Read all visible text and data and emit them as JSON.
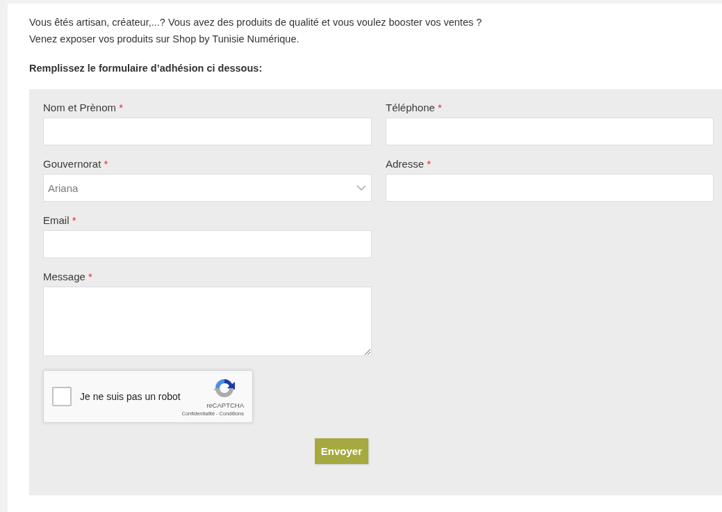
{
  "intro": {
    "lines": [
      "Vous êtés artisan, créateur,...? Vous avez des produits de qualité et vous voulez booster vos ventes ?",
      "Venez exposer vos produits sur Shop by Tunisie Numérique."
    ],
    "heading": "Remplissez le formulaire d’adhésion ci dessous:"
  },
  "form": {
    "rows": [
      [
        {
          "kind": "text",
          "label": "Nom et Prènom",
          "mark": "*"
        },
        {
          "kind": "text",
          "label": "Téléphone",
          "mark": "*"
        }
      ],
      [
        {
          "kind": "select",
          "label": "Gouvernorat",
          "mark": "*",
          "value": "Ariana"
        },
        {
          "kind": "text",
          "label": "Adresse",
          "mark": "*"
        }
      ],
      [
        {
          "kind": "text",
          "label": "Email",
          "mark": "*"
        }
      ],
      [
        {
          "kind": "textarea",
          "label": "Message",
          "mark": "*"
        }
      ]
    ],
    "captcha": {
      "checked": false,
      "label": "Je ne suis pas un robot",
      "brand": "reCAPTCHA",
      "links": [
        "Confidentialité",
        "Conditions"
      ],
      "separator": "-"
    },
    "submit": "Envoyer"
  }
}
